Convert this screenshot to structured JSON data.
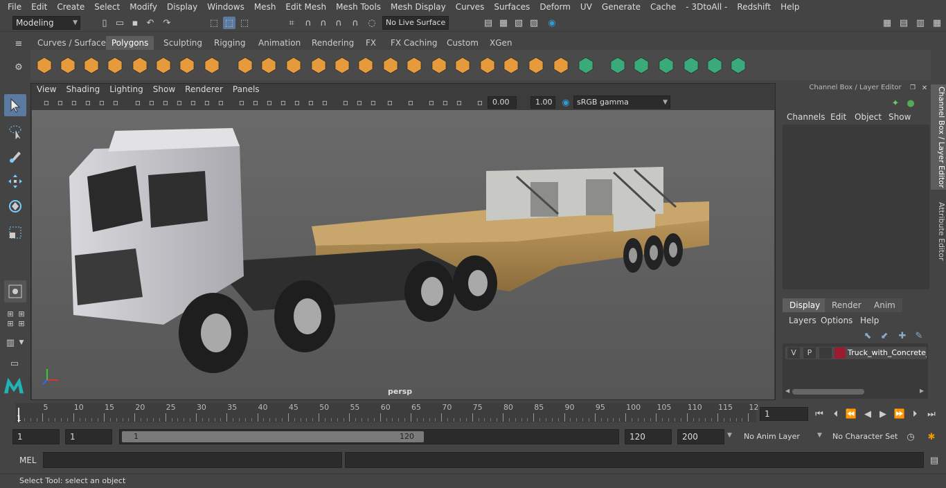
{
  "menubar": [
    "File",
    "Edit",
    "Create",
    "Select",
    "Modify",
    "Display",
    "Windows",
    "Mesh",
    "Edit Mesh",
    "Mesh Tools",
    "Mesh Display",
    "Curves",
    "Surfaces",
    "Deform",
    "UV",
    "Generate",
    "Cache",
    "- 3DtoAll -",
    "Redshift",
    "Help"
  ],
  "toolbar": {
    "mode": "Modeling",
    "live_surface": "No Live Surface"
  },
  "shelf_tabs": [
    "Curves / Surfaces",
    "Polygons",
    "Sculpting",
    "Rigging",
    "Animation",
    "Rendering",
    "FX",
    "FX Caching",
    "Custom",
    "XGen"
  ],
  "shelf_active": "Polygons",
  "viewport": {
    "menu": [
      "View",
      "Shading",
      "Lighting",
      "Show",
      "Renderer",
      "Panels"
    ],
    "exposure": "0.00",
    "gamma": "1.00",
    "colorspace": "sRGB gamma",
    "camera": "persp"
  },
  "channel_box": {
    "title": "Channel Box / Layer Editor",
    "menu": [
      "Channels",
      "Edit",
      "Object",
      "Show"
    ],
    "display_tabs": [
      "Display",
      "Render",
      "Anim"
    ],
    "display_active": "Display",
    "layer_menu": [
      "Layers",
      "Options",
      "Help"
    ],
    "layer": {
      "v": "V",
      "p": "P",
      "name": "Truck_with_Concrete_F",
      "color": "#9b1b30"
    }
  },
  "side_tabs": [
    "Channel Box / Layer Editor",
    "Attribute Editor"
  ],
  "timeline": {
    "ticks": [
      "5",
      "10",
      "15",
      "20",
      "25",
      "30",
      "35",
      "40",
      "45",
      "50",
      "55",
      "60",
      "65",
      "70",
      "75",
      "80",
      "85",
      "90",
      "95",
      "100",
      "105",
      "110",
      "115",
      "12"
    ],
    "start_label": "1",
    "current_frame": "1"
  },
  "range": {
    "start": "1",
    "playback_start": "1",
    "slider_start": "1",
    "slider_end": "120",
    "playback_end": "120",
    "end": "200",
    "anim_layer": "No Anim Layer",
    "char_set": "No Character Set"
  },
  "cmd": {
    "label": "MEL"
  },
  "status": "Select Tool: select an object"
}
